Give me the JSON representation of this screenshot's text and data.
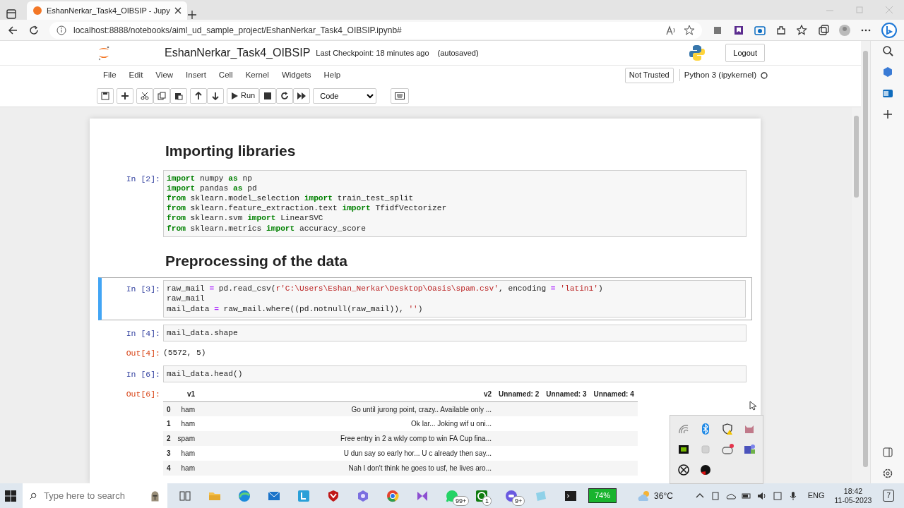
{
  "browser": {
    "tabs": [
      {
        "title": "EshanNerkar_Task4_OIBSIP - Jupy",
        "selected": true
      }
    ],
    "url": "localhost:8888/notebooks/aiml_ud_sample_project/EshanNerkar_Task4_OIBSIP.ipynb#"
  },
  "notebook": {
    "name": "EshanNerkar_Task4_OIBSIP",
    "checkpoint": "Last Checkpoint: 18 minutes ago",
    "autosave": "(autosaved)",
    "logout": "Logout",
    "menu": [
      "File",
      "Edit",
      "View",
      "Insert",
      "Cell",
      "Kernel",
      "Widgets",
      "Help"
    ],
    "trusted": "Not Trusted",
    "kernel": "Python 3 (ipykernel)",
    "kernel_busy": false,
    "run": "Run",
    "cell_type": "Code"
  },
  "cells": [
    {
      "kind": "heading",
      "text": "Importing libraries"
    },
    {
      "kind": "code",
      "prompt": "In [2]:",
      "selected": false,
      "lines": [
        [
          {
            "kind": "keyword",
            "t": "import"
          },
          {
            "kind": "plain",
            "t": " numpy "
          },
          {
            "kind": "keyword",
            "t": "as"
          },
          {
            "kind": "plain",
            "t": " np"
          }
        ],
        [
          {
            "kind": "keyword",
            "t": "import"
          },
          {
            "kind": "plain",
            "t": " pandas "
          },
          {
            "kind": "keyword",
            "t": "as"
          },
          {
            "kind": "plain",
            "t": " pd"
          }
        ],
        [
          {
            "kind": "keyword",
            "t": "from"
          },
          {
            "kind": "plain",
            "t": " sklearn.model_selection "
          },
          {
            "kind": "keyword",
            "t": "import"
          },
          {
            "kind": "plain",
            "t": " train_test_split"
          }
        ],
        [
          {
            "kind": "keyword",
            "t": "from"
          },
          {
            "kind": "plain",
            "t": " sklearn.feature_extraction.text "
          },
          {
            "kind": "keyword",
            "t": "import"
          },
          {
            "kind": "plain",
            "t": " TfidfVectorizer"
          }
        ],
        [
          {
            "kind": "keyword",
            "t": "from"
          },
          {
            "kind": "plain",
            "t": " sklearn.svm "
          },
          {
            "kind": "keyword",
            "t": "import"
          },
          {
            "kind": "plain",
            "t": " LinearSVC"
          }
        ],
        [
          {
            "kind": "keyword",
            "t": "from"
          },
          {
            "kind": "plain",
            "t": " sklearn.metrics "
          },
          {
            "kind": "keyword",
            "t": "import"
          },
          {
            "kind": "plain",
            "t": " accuracy_score"
          }
        ]
      ]
    },
    {
      "kind": "heading",
      "text": "Preprocessing of the data"
    },
    {
      "kind": "code",
      "prompt": "In [3]:",
      "selected": true,
      "lines": [
        [
          {
            "kind": "plain",
            "t": "raw_mail "
          },
          {
            "kind": "operator",
            "t": "="
          },
          {
            "kind": "plain",
            "t": " pd.read_csv("
          },
          {
            "kind": "string",
            "t": "r'C:\\Users\\Eshan_Nerkar\\Desktop\\Oasis\\spam.csv'"
          },
          {
            "kind": "plain",
            "t": ", encoding "
          },
          {
            "kind": "operator",
            "t": "= "
          },
          {
            "kind": "string",
            "t": "'latin1'"
          },
          {
            "kind": "plain",
            "t": ")"
          }
        ],
        [
          {
            "kind": "plain",
            "t": "raw_mail"
          }
        ],
        [
          {
            "kind": "plain",
            "t": "mail_data "
          },
          {
            "kind": "operator",
            "t": "="
          },
          {
            "kind": "plain",
            "t": " raw_mail.where((pd.notnull(raw_mail)), "
          },
          {
            "kind": "string",
            "t": "''"
          },
          {
            "kind": "plain",
            "t": ")"
          }
        ]
      ]
    },
    {
      "kind": "code",
      "prompt": "In [4]:",
      "selected": false,
      "lines": [
        [
          {
            "kind": "plain",
            "t": "mail_data.shape"
          }
        ]
      ],
      "output_prompt": "Out[4]:",
      "output": {
        "kind": "text",
        "text": "(5572, 5)"
      }
    },
    {
      "kind": "code",
      "prompt": "In [6]:",
      "selected": false,
      "lines": [
        [
          {
            "kind": "plain",
            "t": "mail_data.head()"
          }
        ]
      ],
      "output_prompt": "Out[6]:",
      "output": {
        "kind": "table",
        "columns": [
          "v1",
          "v2",
          "Unnamed: 2",
          "Unnamed: 3",
          "Unnamed: 4"
        ],
        "rows": [
          {
            "index": "0",
            "v1": "ham",
            "v2": "Go until jurong point, crazy.. Available only ..."
          },
          {
            "index": "1",
            "v1": "ham",
            "v2": "Ok lar... Joking wif u oni..."
          },
          {
            "index": "2",
            "v1": "spam",
            "v2": "Free entry in 2 a wkly comp to win FA Cup fina..."
          },
          {
            "index": "3",
            "v1": "ham",
            "v2": "U dun say so early hor... U c already then say..."
          },
          {
            "index": "4",
            "v1": "ham",
            "v2": "Nah I don't think he goes to usf, he lives aro..."
          }
        ]
      }
    }
  ],
  "taskbar": {
    "search_placeholder": "Type here to search",
    "badges": [
      "99+",
      "1",
      "9+"
    ],
    "battery": "74%",
    "temperature": "36°C",
    "language": "ENG",
    "time": "18:42",
    "date": "11-05-2023",
    "notifications": "7"
  }
}
